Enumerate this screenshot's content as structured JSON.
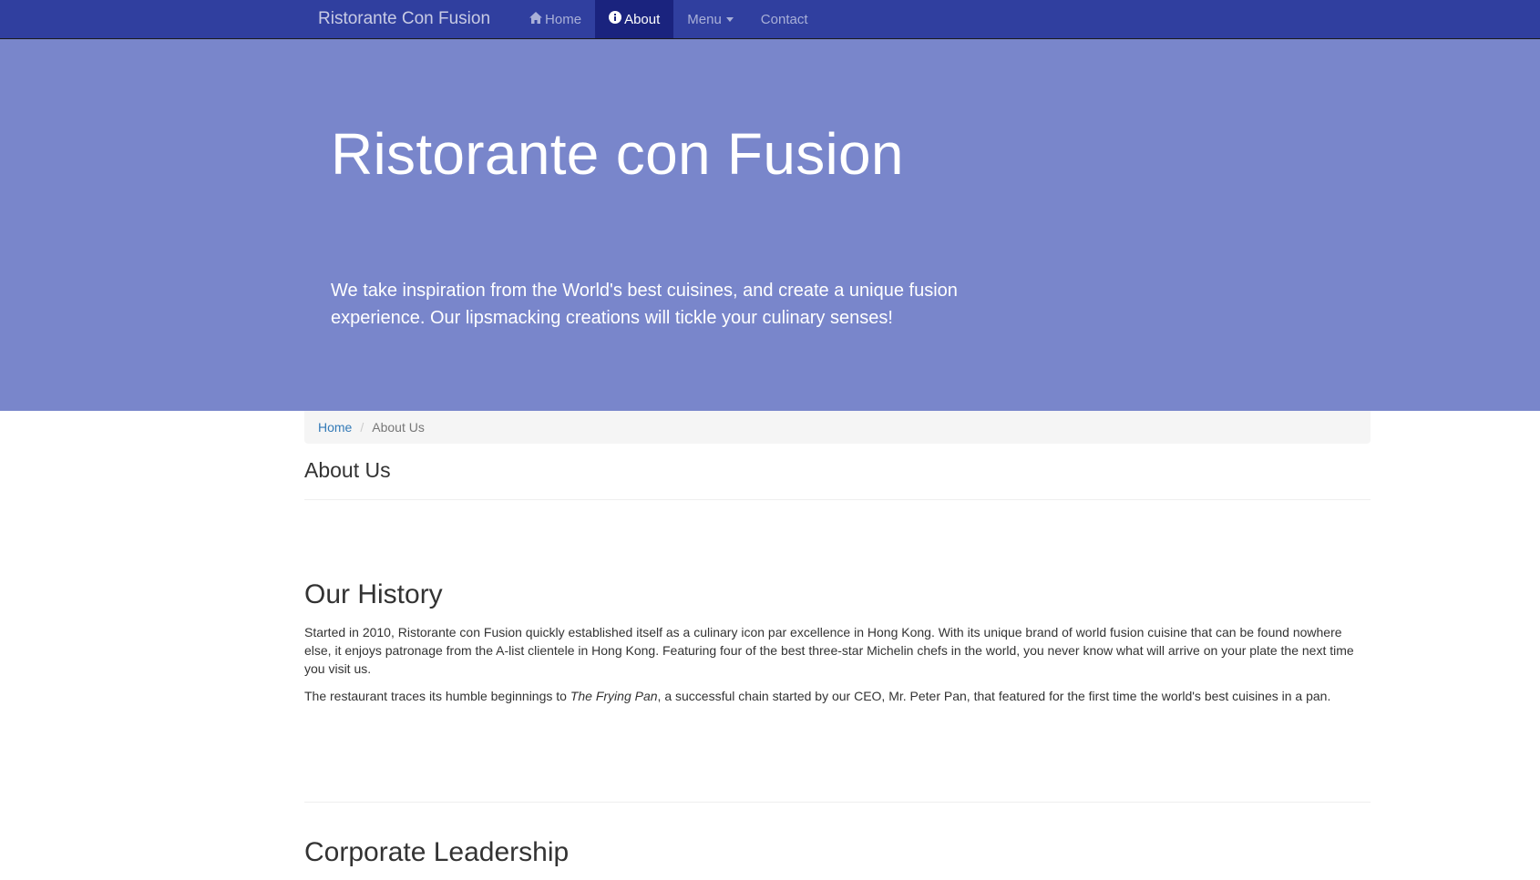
{
  "navbar": {
    "brand": "Ristorante Con Fusion",
    "items": [
      {
        "label": "Home",
        "icon": "home-icon"
      },
      {
        "label": "About",
        "icon": "info-circle-icon"
      },
      {
        "label": "Menu",
        "icon": "caret-down-icon"
      },
      {
        "label": "Contact"
      }
    ]
  },
  "jumbotron": {
    "title": "Ristorante con Fusion",
    "tagline": "We take inspiration from the World's best cuisines, and create a unique fusion experience. Our lipsmacking creations will tickle your culinary senses!"
  },
  "breadcrumb": {
    "home": "Home",
    "separator": "/",
    "current": "About Us"
  },
  "page_title": "About Us",
  "history": {
    "heading": "Our History",
    "paragraph1": "Started in 2010, Ristorante con Fusion quickly established itself as a culinary icon par excellence in Hong Kong. With its unique brand of world fusion cuisine that can be found nowhere else, it enjoys patronage from the A-list clientele in Hong Kong. Featuring four of the best three-star Michelin chefs in the world, you never know what will arrive on your plate the next time you visit us.",
    "paragraph2_before": "The restaurant traces its humble beginnings to ",
    "paragraph2_emph": "The Frying Pan",
    "paragraph2_after": ", a successful chain started by our CEO, Mr. Peter Pan, that featured for the first time the world's best cuisines in a pan."
  },
  "leadership": {
    "heading": "Corporate Leadership"
  },
  "colors": {
    "navbar": "#303F9F",
    "navbar_active": "#1A237E",
    "jumbotron": "#7986CB",
    "link": "#337ab7"
  }
}
